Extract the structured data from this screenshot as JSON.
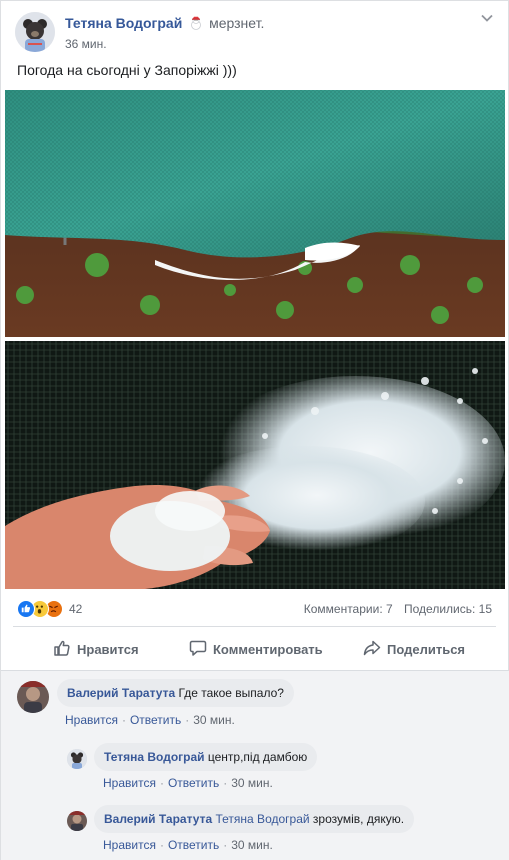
{
  "post": {
    "author": "Тетяна Водограй",
    "feeling": "мерзнет.",
    "feeling_icon": "snowman-icon",
    "time": "36 мин.",
    "text": "Погода на сьогодні у Запоріжжі )))"
  },
  "stats": {
    "reactions_count": "42",
    "reaction_types": [
      "like",
      "wow",
      "angry"
    ],
    "comments": "Комментарии: 7",
    "shares": "Поделились: 15"
  },
  "actions": {
    "like": "Нравится",
    "comment": "Комментировать",
    "share": "Поделиться"
  },
  "comments": [
    {
      "author": "Валерий Таратута",
      "text": "Где такое выпало?",
      "like": "Нравится",
      "reply": "Ответить",
      "time": "30 мин."
    },
    {
      "author": "Тетяна Водограй",
      "text": "центр,під дамбою",
      "like": "Нравится",
      "reply": "Ответить",
      "time": "30 мин."
    },
    {
      "author": "Валерий Таратута",
      "mention": "Тетяна Водограй",
      "text": "зрозумів, дякую.",
      "like": "Нравится",
      "reply": "Ответить",
      "time": "30 мин."
    }
  ],
  "colors": {
    "link": "#365899",
    "like_blue": "#1877f2",
    "bubble": "#e9ebee"
  }
}
